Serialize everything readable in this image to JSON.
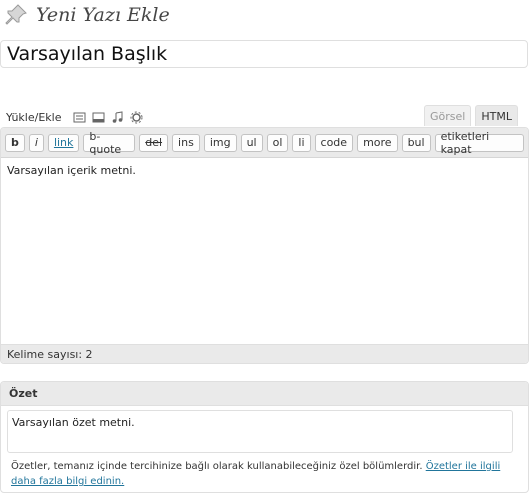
{
  "page": {
    "title": "Yeni Yazı Ekle"
  },
  "post": {
    "title_value": "Varsayılan Başlık"
  },
  "media": {
    "label": "Yükle/Ekle",
    "icons": [
      "image-icon",
      "video-icon",
      "audio-icon",
      "media-gear-icon"
    ]
  },
  "editor": {
    "tabs": {
      "visual": "Görsel",
      "html": "HTML"
    },
    "quicktags": [
      "b",
      "i",
      "link",
      "b-quote",
      "del",
      "ins",
      "img",
      "ul",
      "ol",
      "li",
      "code",
      "more",
      "bul",
      "etiketleri kapat"
    ],
    "content": "Varsayılan içerik metni.",
    "word_count": "Kelime sayısı: 2"
  },
  "excerpt": {
    "heading": "Özet",
    "value": "Varsayılan özet metni.",
    "help_text": "Özetler, temanız içinde tercihinize bağlı olarak kullanabileceğiniz özel bölümlerdir.",
    "help_link": "Özetler ile ilgili daha fazla bilgi edinin."
  },
  "colors": {
    "link": "#21759b",
    "toolbar_bg": "#eaeaea",
    "border": "#dfdfdf"
  }
}
